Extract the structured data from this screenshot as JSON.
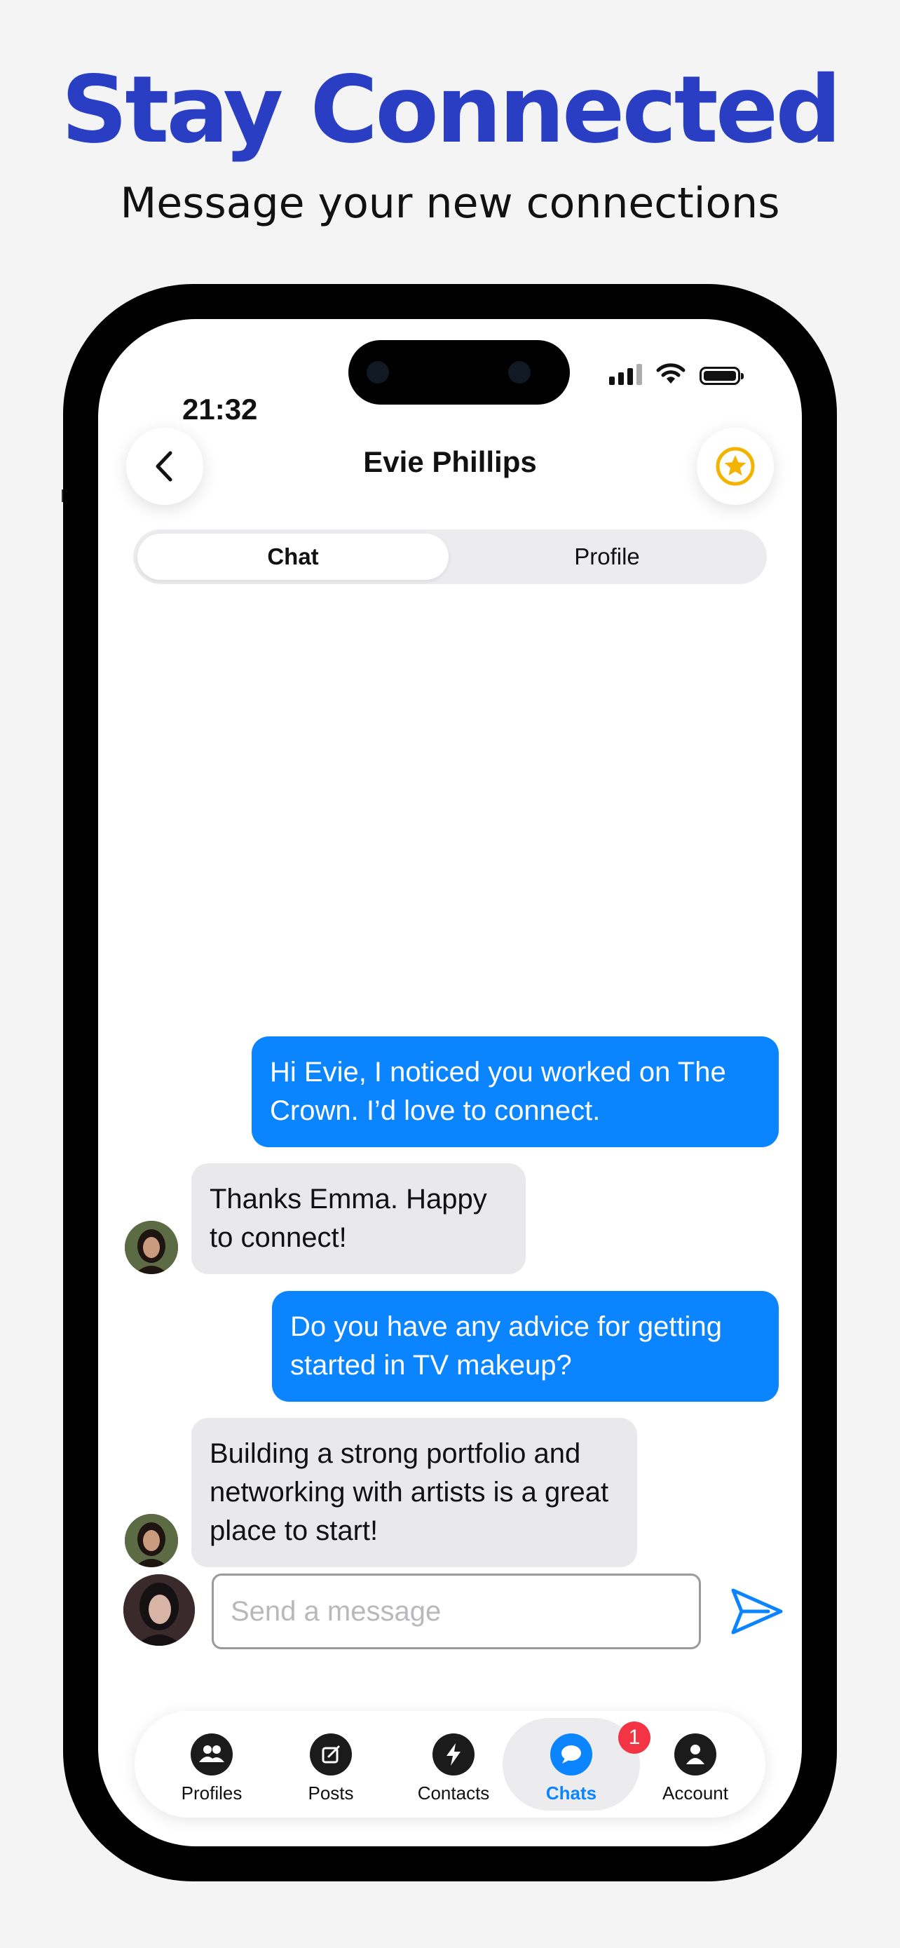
{
  "promo": {
    "headline": "Stay Connected",
    "subheadline": "Message your new connections"
  },
  "status_bar": {
    "time": "21:32"
  },
  "header": {
    "contact_name": "Evie Phillips",
    "back_icon": "chevron-left-icon",
    "favorite_icon": "star-icon"
  },
  "segment": {
    "tabs": [
      {
        "label": "Chat",
        "selected": true
      },
      {
        "label": "Profile",
        "selected": false
      }
    ]
  },
  "messages": [
    {
      "direction": "outgoing",
      "text": "Hi Evie, I noticed you worked on The Crown. I’d love to connect."
    },
    {
      "direction": "incoming",
      "text": "Thanks Emma. Happy to connect!"
    },
    {
      "direction": "outgoing",
      "text": "Do you have any advice for getting started in TV makeup?"
    },
    {
      "direction": "incoming",
      "text": "Building a strong portfolio and networking with artists is a great place to start!"
    }
  ],
  "composer": {
    "placeholder": "Send a message",
    "value": "",
    "send_icon": "send-icon"
  },
  "tabbar": {
    "items": [
      {
        "label": "Profiles",
        "icon": "people-icon"
      },
      {
        "label": "Posts",
        "icon": "edit-icon"
      },
      {
        "label": "Contacts",
        "icon": "bolt-icon"
      },
      {
        "label": "Chats",
        "icon": "chat-bubble-icon",
        "badge": "1",
        "active": true
      },
      {
        "label": "Account",
        "icon": "person-icon"
      }
    ]
  },
  "colors": {
    "headline": "#2a3ec4",
    "accent": "#0a84ff",
    "star": "#f5b301",
    "badge": "#f23444"
  }
}
